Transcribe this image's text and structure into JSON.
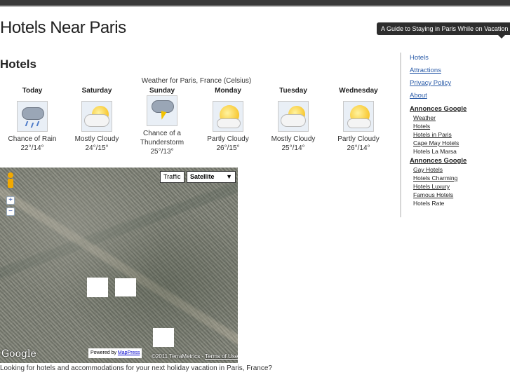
{
  "site": {
    "title": "Hotels Near Paris",
    "tagline": "A Guide to Staying in Paris While on Vacation"
  },
  "main": {
    "section_title": "Hotels",
    "weather": {
      "caption": "Weather for Paris, France (Celsius)",
      "days": [
        {
          "name": "Today",
          "condition": "Chance of Rain",
          "temp": "22°/14°",
          "icon": "rain-icon"
        },
        {
          "name": "Saturday",
          "condition": "Mostly Cloudy",
          "temp": "24°/15°",
          "icon": "mostly-cloudy-icon"
        },
        {
          "name": "Sunday",
          "condition": "Chance of a Thunderstorm",
          "temp": "25°/13°",
          "icon": "thunderstorm-icon"
        },
        {
          "name": "Monday",
          "condition": "Partly Cloudy",
          "temp": "26°/15°",
          "icon": "partly-cloudy-icon"
        },
        {
          "name": "Tuesday",
          "condition": "Mostly Cloudy",
          "temp": "25°/14°",
          "icon": "mostly-cloudy-icon"
        },
        {
          "name": "Wednesday",
          "condition": "Partly Cloudy",
          "temp": "26°/14°",
          "icon": "partly-cloudy-icon"
        }
      ]
    },
    "map": {
      "traffic_label": "Traffic",
      "satellite_label": "Satellite",
      "dropdown_glyph": "▼",
      "zoom_in": "+",
      "zoom_out": "−",
      "google_logo": "Google",
      "powered_prefix": "Powered by",
      "powered_link": "MapPress",
      "copyright": "©2011 TerraMetrics -",
      "terms": "Terms of Use"
    },
    "intro_text": "Looking for hotels and accommodations for your next holiday vacation in Paris, France?"
  },
  "sidebar": {
    "nav": [
      {
        "label": "Hotels",
        "underlined": false
      },
      {
        "label": "Attractions",
        "underlined": true
      },
      {
        "label": "Privacy Policy",
        "underlined": true
      },
      {
        "label": "About",
        "underlined": true
      }
    ],
    "annonces": [
      {
        "title": "Annonces Google",
        "links": [
          "Weather",
          "Hotels",
          "Hotels in Paris",
          "Cape May Hotels",
          "Hotels La Marsa"
        ]
      },
      {
        "title": "Annonces Google",
        "links": [
          "Gay Hotels",
          "Hotels Charming",
          "Hotels Luxury",
          "Famous Hotels",
          "Hotels Rate"
        ]
      }
    ]
  }
}
